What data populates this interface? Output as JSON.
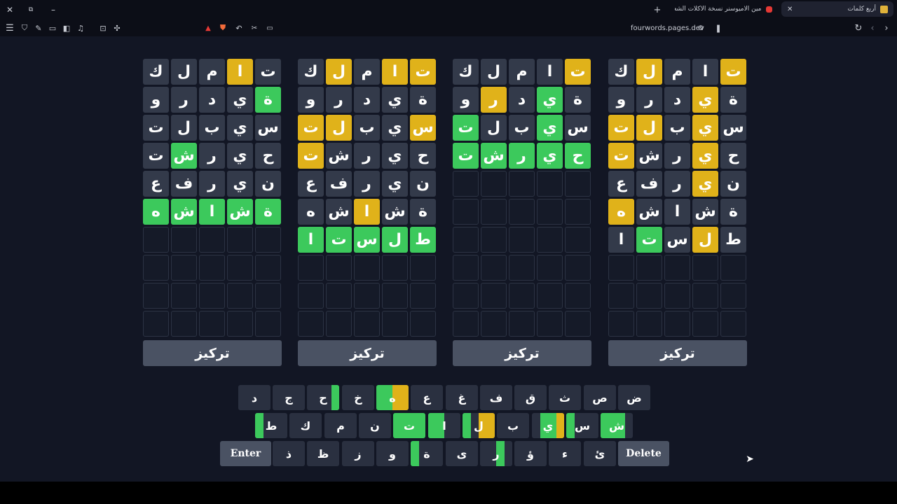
{
  "browser": {
    "tabs": [
      {
        "title": "أربع كلمات",
        "active": true
      },
      {
        "title": "مين الاميوسنر نسخة الاكلات الشعبية 🍔 !",
        "active": false
      }
    ],
    "url": "fourwords.pages.dev"
  },
  "colors": {
    "green": "#3cc95c",
    "yellow": "#e0b21a",
    "tile": "#333a4a",
    "background": "#121624"
  },
  "focus_label": "تركيز",
  "boards": [
    {
      "rows": [
        [
          {
            "l": "ت",
            "s": "n"
          },
          {
            "l": "ا",
            "s": "y"
          },
          {
            "l": "م",
            "s": "n"
          },
          {
            "l": "ل",
            "s": "n"
          },
          {
            "l": "ك",
            "s": "n"
          }
        ],
        [
          {
            "l": "ة",
            "s": "g"
          },
          {
            "l": "ي",
            "s": "n"
          },
          {
            "l": "د",
            "s": "n"
          },
          {
            "l": "ر",
            "s": "n"
          },
          {
            "l": "و",
            "s": "n"
          }
        ],
        [
          {
            "l": "س",
            "s": "n"
          },
          {
            "l": "ي",
            "s": "n"
          },
          {
            "l": "ب",
            "s": "n"
          },
          {
            "l": "ل",
            "s": "n"
          },
          {
            "l": "ت",
            "s": "n"
          }
        ],
        [
          {
            "l": "ح",
            "s": "n"
          },
          {
            "l": "ي",
            "s": "n"
          },
          {
            "l": "ر",
            "s": "n"
          },
          {
            "l": "ش",
            "s": "g"
          },
          {
            "l": "ت",
            "s": "n"
          }
        ],
        [
          {
            "l": "ن",
            "s": "n"
          },
          {
            "l": "ي",
            "s": "n"
          },
          {
            "l": "ر",
            "s": "n"
          },
          {
            "l": "ف",
            "s": "n"
          },
          {
            "l": "ع",
            "s": "n"
          }
        ],
        [
          {
            "l": "ة",
            "s": "g"
          },
          {
            "l": "ش",
            "s": "g"
          },
          {
            "l": "ا",
            "s": "g"
          },
          {
            "l": "ش",
            "s": "g"
          },
          {
            "l": "ه",
            "s": "g"
          }
        ]
      ]
    },
    {
      "rows": [
        [
          {
            "l": "ت",
            "s": "y"
          },
          {
            "l": "ا",
            "s": "y"
          },
          {
            "l": "م",
            "s": "n"
          },
          {
            "l": "ل",
            "s": "y"
          },
          {
            "l": "ك",
            "s": "n"
          }
        ],
        [
          {
            "l": "ة",
            "s": "n"
          },
          {
            "l": "ي",
            "s": "n"
          },
          {
            "l": "د",
            "s": "n"
          },
          {
            "l": "ر",
            "s": "n"
          },
          {
            "l": "و",
            "s": "n"
          }
        ],
        [
          {
            "l": "س",
            "s": "y"
          },
          {
            "l": "ي",
            "s": "n"
          },
          {
            "l": "ب",
            "s": "n"
          },
          {
            "l": "ل",
            "s": "y"
          },
          {
            "l": "ت",
            "s": "y"
          }
        ],
        [
          {
            "l": "ح",
            "s": "n"
          },
          {
            "l": "ي",
            "s": "n"
          },
          {
            "l": "ر",
            "s": "n"
          },
          {
            "l": "ش",
            "s": "n"
          },
          {
            "l": "ت",
            "s": "y"
          }
        ],
        [
          {
            "l": "ن",
            "s": "n"
          },
          {
            "l": "ي",
            "s": "n"
          },
          {
            "l": "ر",
            "s": "n"
          },
          {
            "l": "ف",
            "s": "n"
          },
          {
            "l": "ع",
            "s": "n"
          }
        ],
        [
          {
            "l": "ة",
            "s": "n"
          },
          {
            "l": "ش",
            "s": "n"
          },
          {
            "l": "ا",
            "s": "y"
          },
          {
            "l": "ش",
            "s": "n"
          },
          {
            "l": "ه",
            "s": "n"
          }
        ],
        [
          {
            "l": "ط",
            "s": "g"
          },
          {
            "l": "ل",
            "s": "g"
          },
          {
            "l": "س",
            "s": "g"
          },
          {
            "l": "ت",
            "s": "g"
          },
          {
            "l": "ا",
            "s": "g"
          }
        ]
      ]
    },
    {
      "rows": [
        [
          {
            "l": "ت",
            "s": "y"
          },
          {
            "l": "ا",
            "s": "n"
          },
          {
            "l": "م",
            "s": "n"
          },
          {
            "l": "ل",
            "s": "n"
          },
          {
            "l": "ك",
            "s": "n"
          }
        ],
        [
          {
            "l": "ة",
            "s": "n"
          },
          {
            "l": "ي",
            "s": "g"
          },
          {
            "l": "د",
            "s": "n"
          },
          {
            "l": "ر",
            "s": "y"
          },
          {
            "l": "و",
            "s": "n"
          }
        ],
        [
          {
            "l": "س",
            "s": "n"
          },
          {
            "l": "ي",
            "s": "g"
          },
          {
            "l": "ب",
            "s": "n"
          },
          {
            "l": "ل",
            "s": "n"
          },
          {
            "l": "ت",
            "s": "g"
          }
        ],
        [
          {
            "l": "ح",
            "s": "g"
          },
          {
            "l": "ي",
            "s": "g"
          },
          {
            "l": "ر",
            "s": "g"
          },
          {
            "l": "ش",
            "s": "g"
          },
          {
            "l": "ت",
            "s": "g"
          }
        ]
      ]
    },
    {
      "rows": [
        [
          {
            "l": "ت",
            "s": "y"
          },
          {
            "l": "ا",
            "s": "n"
          },
          {
            "l": "م",
            "s": "n"
          },
          {
            "l": "ل",
            "s": "y"
          },
          {
            "l": "ك",
            "s": "n"
          }
        ],
        [
          {
            "l": "ة",
            "s": "n"
          },
          {
            "l": "ي",
            "s": "y"
          },
          {
            "l": "د",
            "s": "n"
          },
          {
            "l": "ر",
            "s": "n"
          },
          {
            "l": "و",
            "s": "n"
          }
        ],
        [
          {
            "l": "س",
            "s": "n"
          },
          {
            "l": "ي",
            "s": "y"
          },
          {
            "l": "ب",
            "s": "n"
          },
          {
            "l": "ل",
            "s": "y"
          },
          {
            "l": "ت",
            "s": "y"
          }
        ],
        [
          {
            "l": "ح",
            "s": "n"
          },
          {
            "l": "ي",
            "s": "y"
          },
          {
            "l": "ر",
            "s": "n"
          },
          {
            "l": "ش",
            "s": "n"
          },
          {
            "l": "ت",
            "s": "y"
          }
        ],
        [
          {
            "l": "ن",
            "s": "n"
          },
          {
            "l": "ي",
            "s": "y"
          },
          {
            "l": "ر",
            "s": "n"
          },
          {
            "l": "ف",
            "s": "n"
          },
          {
            "l": "ع",
            "s": "n"
          }
        ],
        [
          {
            "l": "ة",
            "s": "n"
          },
          {
            "l": "ش",
            "s": "n"
          },
          {
            "l": "ا",
            "s": "n"
          },
          {
            "l": "ش",
            "s": "n"
          },
          {
            "l": "ه",
            "s": "y"
          }
        ],
        [
          {
            "l": "ط",
            "s": "n"
          },
          {
            "l": "ل",
            "s": "y"
          },
          {
            "l": "س",
            "s": "n"
          },
          {
            "l": "ت",
            "s": "g"
          },
          {
            "l": "ا",
            "s": "n"
          }
        ]
      ]
    }
  ],
  "keyboard": [
    [
      {
        "k": "ض"
      },
      {
        "k": "ص"
      },
      {
        "k": "ث"
      },
      {
        "k": "ق"
      },
      {
        "k": "ف"
      },
      {
        "k": "غ"
      },
      {
        "k": "ع"
      },
      {
        "k": "ه",
        "q": "ggyy"
      },
      {
        "k": "خ"
      },
      {
        "k": "ح",
        "q": "dddg"
      },
      {
        "k": "ج"
      },
      {
        "k": "د"
      }
    ],
    [
      {
        "k": "ش",
        "q": "gggd"
      },
      {
        "k": "س",
        "q": "gddd"
      },
      {
        "k": "ي",
        "q": "dggy"
      },
      {
        "k": "ب"
      },
      {
        "k": "ل",
        "q": "gdyy"
      },
      {
        "k": "ا",
        "q": "ggdd"
      },
      {
        "k": "ت",
        "q": "gggg"
      },
      {
        "k": "ن"
      },
      {
        "k": "م"
      },
      {
        "k": "ك"
      },
      {
        "k": "ط",
        "q": "gddd"
      }
    ],
    [
      {
        "k": "Delete",
        "wide": true
      },
      {
        "k": "ئ"
      },
      {
        "k": "ء"
      },
      {
        "k": "ؤ"
      },
      {
        "k": "ر",
        "q": "ddgd"
      },
      {
        "k": "ى"
      },
      {
        "k": "ة",
        "q": "gddd"
      },
      {
        "k": "و"
      },
      {
        "k": "ز"
      },
      {
        "k": "ظ"
      },
      {
        "k": "ذ"
      },
      {
        "k": "Enter",
        "wide": true
      }
    ]
  ]
}
